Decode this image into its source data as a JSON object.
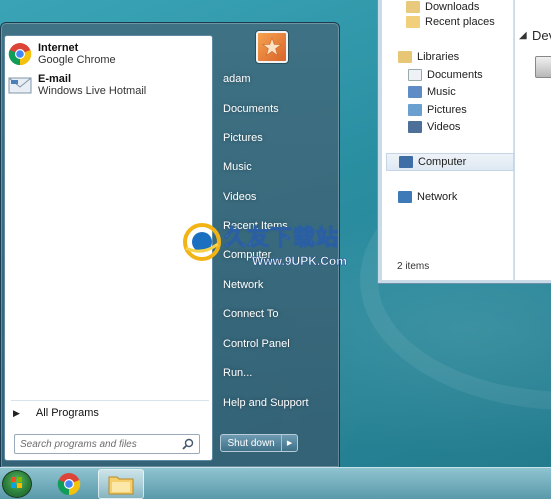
{
  "explorer": {
    "nav_items": [
      {
        "label": "Downloads",
        "icon": "downloads-folder-icon"
      },
      {
        "label": "Recent places",
        "icon": "recent-places-icon"
      },
      {
        "label": "Libraries",
        "icon": "libraries-icon"
      },
      {
        "label": "Documents",
        "icon": "documents-icon"
      },
      {
        "label": "Music",
        "icon": "music-icon"
      },
      {
        "label": "Pictures",
        "icon": "pictures-icon"
      },
      {
        "label": "Videos",
        "icon": "videos-icon"
      },
      {
        "label": "Computer",
        "icon": "computer-icon",
        "selected": true
      },
      {
        "label": "Network",
        "icon": "network-icon"
      }
    ],
    "status": "2 items",
    "content_label": "Dev"
  },
  "start_menu": {
    "pinned": [
      {
        "title": "Internet",
        "subtitle": "Google Chrome",
        "icon": "chrome-icon"
      },
      {
        "title": "E-mail",
        "subtitle": "Windows Live Hotmail",
        "icon": "mail-icon"
      }
    ],
    "all_programs": "All Programs",
    "search_placeholder": "Search programs and files",
    "right_items": [
      "adam",
      "Documents",
      "Pictures",
      "Music",
      "Videos",
      "Recent Items",
      "Computer",
      "Network",
      "Connect To",
      "Control Panel",
      "Run...",
      "Help and Support"
    ],
    "shutdown_label": "Shut down"
  },
  "watermark": {
    "text": "久友下载站",
    "url": "Www.9UPK.Com"
  },
  "colors": {
    "desktop": "#2a8ea1",
    "start_menu": "#406e80",
    "taskbar": "#7ab3c2"
  }
}
